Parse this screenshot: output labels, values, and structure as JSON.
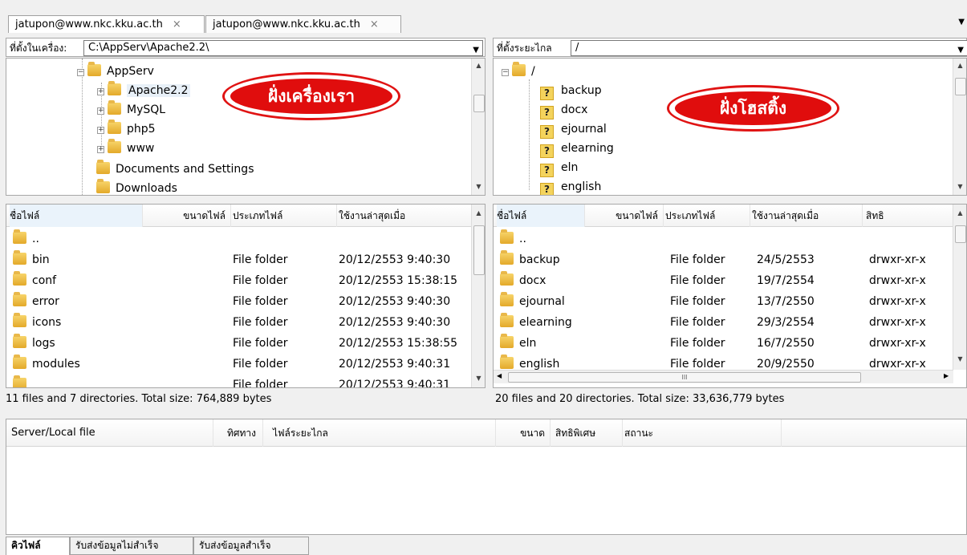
{
  "tabs": [
    {
      "label": "jatupon@www.nkc.kku.ac.th"
    },
    {
      "label": "jatupon@www.nkc.kku.ac.th"
    }
  ],
  "tab_close_glyph": "×",
  "local": {
    "path_label": "ที่ตั้งในเครื่อง:",
    "path_value": "C:\\AppServ\\Apache2.2\\",
    "tree": [
      {
        "label": "AppServ"
      },
      {
        "label": "Apache2.2"
      },
      {
        "label": "MySQL"
      },
      {
        "label": "php5"
      },
      {
        "label": "www"
      },
      {
        "label": "Documents and Settings"
      },
      {
        "label": "Downloads"
      }
    ],
    "annotation": "ฝั่งเครื่องเรา",
    "columns": [
      "ชื่อไฟล์",
      "ขนาดไฟล์",
      "ประเภทไฟล์",
      "ใช้งานล่าสุดเมื่อ"
    ],
    "rows": [
      {
        "name": "..",
        "type": "",
        "modified": ""
      },
      {
        "name": "bin",
        "type": "File folder",
        "modified": "20/12/2553 9:40:30"
      },
      {
        "name": "conf",
        "type": "File folder",
        "modified": "20/12/2553 15:38:15"
      },
      {
        "name": "error",
        "type": "File folder",
        "modified": "20/12/2553 9:40:30"
      },
      {
        "name": "icons",
        "type": "File folder",
        "modified": "20/12/2553 9:40:30"
      },
      {
        "name": "logs",
        "type": "File folder",
        "modified": "20/12/2553 15:38:55"
      },
      {
        "name": "modules",
        "type": "File folder",
        "modified": "20/12/2553 9:40:31"
      },
      {
        "name": "",
        "type": "File folder",
        "modified": "20/12/2553 9:40:31"
      }
    ],
    "status": "11 files and 7 directories. Total size: 764,889 bytes"
  },
  "remote": {
    "path_label": "ที่ตั้งระยะไกล",
    "path_value": "/",
    "tree": [
      {
        "label": "/"
      },
      {
        "label": "backup"
      },
      {
        "label": "docx"
      },
      {
        "label": "ejournal"
      },
      {
        "label": "elearning"
      },
      {
        "label": "eln"
      },
      {
        "label": "english"
      }
    ],
    "unknown_glyph": "?",
    "annotation": "ฝั่งโฮสติ้ง",
    "columns": [
      "ชื่อไฟล์",
      "ขนาดไฟล์",
      "ประเภทไฟล์",
      "ใช้งานล่าสุดเมื่อ",
      "สิทธิ"
    ],
    "rows": [
      {
        "name": "..",
        "type": "",
        "modified": "",
        "perm": ""
      },
      {
        "name": "backup",
        "type": "File folder",
        "modified": "24/5/2553",
        "perm": "drwxr-xr-x"
      },
      {
        "name": "docx",
        "type": "File folder",
        "modified": "19/7/2554",
        "perm": "drwxr-xr-x"
      },
      {
        "name": "ejournal",
        "type": "File folder",
        "modified": "13/7/2550",
        "perm": "drwxr-xr-x"
      },
      {
        "name": "elearning",
        "type": "File folder",
        "modified": "29/3/2554",
        "perm": "drwxr-xr-x"
      },
      {
        "name": "eln",
        "type": "File folder",
        "modified": "16/7/2550",
        "perm": "drwxr-xr-x"
      },
      {
        "name": "english",
        "type": "File folder",
        "modified": "20/9/2550",
        "perm": "drwxr-xr-x"
      }
    ],
    "hscroll_grip": "III",
    "status": "20 files and 20 directories. Total size: 33,636,779 bytes"
  },
  "queue": {
    "columns": [
      "Server/Local file",
      "ทิศทาง",
      "ไฟล์ระยะไกล",
      "ขนาด",
      "สิทธิพิเศษ",
      "สถานะ"
    ]
  },
  "bottom_tabs": [
    {
      "label": "คิวไฟล์"
    },
    {
      "label": "รับส่งข้อมูลไม่สำเร็จ"
    },
    {
      "label": "รับส่งข้อมูลสำเร็จ"
    }
  ],
  "colors": {
    "annotation": "#e00d0d",
    "annotation_text": "#ffffff"
  },
  "icons": {
    "folder": "folder-icon",
    "unknown": "unknown-folder-icon",
    "expand": "plus-box-icon",
    "collapse": "minus-box-icon"
  }
}
